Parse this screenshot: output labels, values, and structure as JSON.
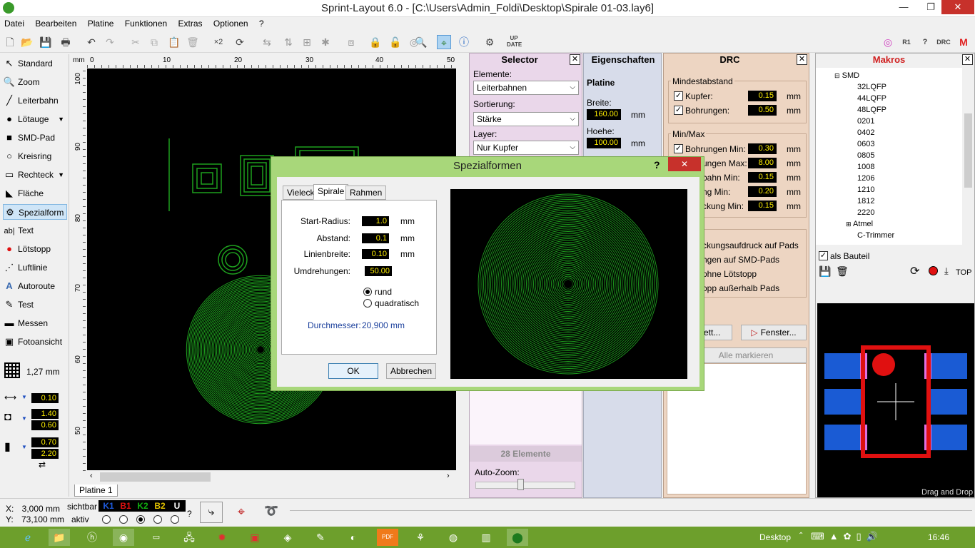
{
  "window": {
    "title": "Sprint-Layout 6.0 - [C:\\Users\\Admin_Foldi\\Desktop\\Spirale 01-03.lay6]",
    "minimize_glyph": "—",
    "restore_glyph": "❐",
    "close_glyph": "✕"
  },
  "menu": [
    "Datei",
    "Bearbeiten",
    "Platine",
    "Funktionen",
    "Extras",
    "Optionen",
    "?"
  ],
  "tools": [
    {
      "label": "Standard",
      "icon": "↖"
    },
    {
      "label": "Zoom",
      "icon": "🔍"
    },
    {
      "label": "Leiterbahn",
      "icon": "╱"
    },
    {
      "label": "Lötauge",
      "icon": "●"
    },
    {
      "label": "SMD-Pad",
      "icon": "■"
    },
    {
      "label": "Kreisring",
      "icon": "○"
    },
    {
      "label": "Rechteck",
      "icon": "▭"
    },
    {
      "label": "Fläche",
      "icon": "◣"
    },
    {
      "label": "Spezialform",
      "icon": "⚙"
    },
    {
      "label": "Text",
      "icon": "ab|"
    },
    {
      "label": "Lötstopp",
      "icon": "●"
    },
    {
      "label": "Luftlinie",
      "icon": "⋰"
    },
    {
      "label": "Autoroute",
      "icon": "A"
    },
    {
      "label": "Test",
      "icon": "✎"
    },
    {
      "label": "Messen",
      "icon": "▬"
    },
    {
      "label": "Fotoansicht",
      "icon": "▣"
    }
  ],
  "grid": {
    "value": "1,27 mm"
  },
  "params": {
    "width": "0.10",
    "pad_outer": "1.40",
    "pad_inner": "0.60",
    "smd_w": "0.70",
    "smd_h": "2.20"
  },
  "ruler": {
    "unit": "mm",
    "h_ticks": [
      "0",
      "10",
      "20",
      "30",
      "40",
      "50"
    ],
    "v_ticks": [
      "100",
      "90",
      "80",
      "70",
      "60",
      "50"
    ]
  },
  "board_tab": "Platine 1",
  "selector": {
    "title": "Selector",
    "elemente_label": "Elemente:",
    "elemente_value": "Leiterbahnen",
    "sortierung_label": "Sortierung:",
    "sortierung_value": "Stärke",
    "layer_label": "Layer:",
    "layer_value": "Nur Kupfer",
    "count": "28 Elemente",
    "autozoom_label": "Auto-Zoom:"
  },
  "eigenschaften": {
    "title": "Eigenschaften",
    "section": "Platine",
    "breite_label": "Breite:",
    "breite_value": "160.00",
    "hoehe_label": "Hoehe:",
    "hoehe_value": "100.00",
    "unit": "mm"
  },
  "drc": {
    "title": "DRC",
    "mindestabstand": "Mindestabstand",
    "kupfer_label": "Kupfer:",
    "kupfer_value": "0.15",
    "bohrungen_label": "Bohrungen:",
    "bohrungen_value": "0.50",
    "minmax": "Min/Max",
    "rows": [
      {
        "label": "Bohrungen Min:",
        "value": "0.30"
      },
      {
        "label": "ungen Max:",
        "value": "8.00"
      },
      {
        "label": "bahn Min:",
        "value": "0.15"
      },
      {
        "label": "ng Min:",
        "value": "0.20"
      },
      {
        "label": "ckung Min:",
        "value": "0.15"
      }
    ],
    "checks": [
      "ckungsaufdruck auf Pads",
      "ngen auf SMD-Pads",
      "ohne Lötstopp",
      "opp außerhalb Pads"
    ],
    "btn_komplett": "plett...",
    "btn_fenster": "Fenster...",
    "btn_alle": "Alle markieren",
    "unit": "mm"
  },
  "makros": {
    "title": "Makros",
    "tree": [
      "SMD",
      "32LQFP",
      "44LQFP",
      "48LQFP",
      "0201",
      "0402",
      "0603",
      "0805",
      "1008",
      "1206",
      "1210",
      "1812",
      "2220",
      "Atmel",
      "C-Trimmer"
    ],
    "als_bauteil": "als Bauteil",
    "top_label": "TOP",
    "drag_drop": "Drag and Drop"
  },
  "dialog": {
    "title": "Spezialformen",
    "help": "?",
    "close": "✕",
    "tabs": [
      "Vieleck",
      "Spirale",
      "Rahmen"
    ],
    "start_radius_label": "Start-Radius:",
    "start_radius_value": "1.0",
    "abstand_label": "Abstand:",
    "abstand_value": "0.1",
    "linienbreite_label": "Linienbreite:",
    "linienbreite_value": "0.10",
    "umdrehungen_label": "Umdrehungen:",
    "umdrehungen_value": "50.00",
    "unit": "mm",
    "radio_rund": "rund",
    "radio_quadratisch": "quadratisch",
    "durchmesser_label": "Durchmesser:",
    "durchmesser_value": "20,900 mm",
    "ok": "OK",
    "cancel": "Abbrechen"
  },
  "status": {
    "x_label": "X:",
    "x_value": "3,000 mm",
    "y_label": "Y:",
    "y_value": "73,100 mm",
    "sichtbar": "sichtbar",
    "aktiv": "aktiv",
    "layers": [
      {
        "name": "K1",
        "color": "#1e5adc"
      },
      {
        "name": "B1",
        "color": "#e01010"
      },
      {
        "name": "K2",
        "color": "#10b010"
      },
      {
        "name": "B2",
        "color": "#e0c000"
      },
      {
        "name": "U",
        "color": "#ffffff"
      }
    ],
    "help": "?"
  },
  "taskbar": {
    "desktop": "Desktop",
    "time": "16:46"
  }
}
